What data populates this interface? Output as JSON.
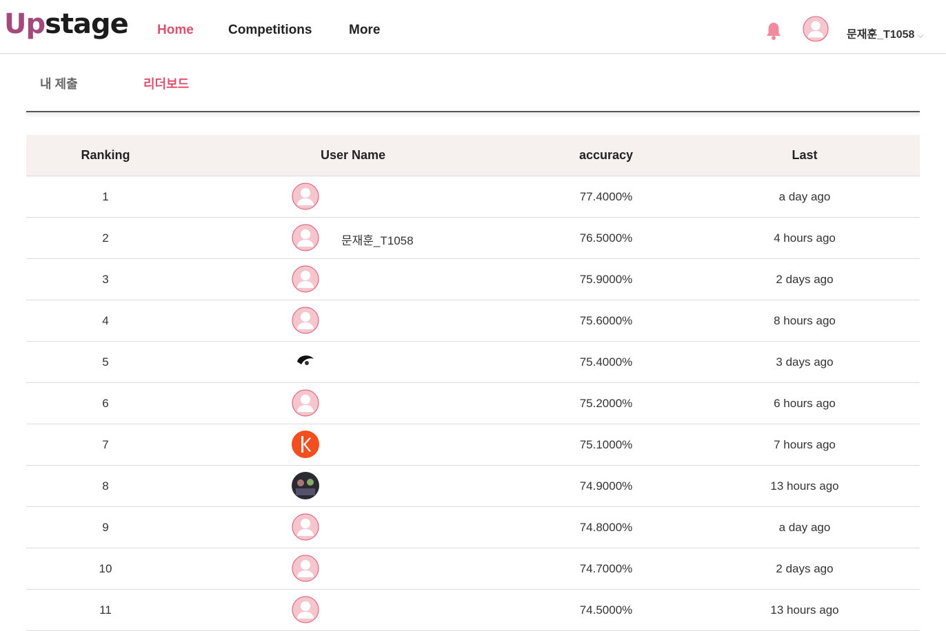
{
  "header": {
    "logo_up": "Up",
    "logo_stage": "stage",
    "nav": [
      {
        "label": "Home",
        "active": true
      },
      {
        "label": "Competitions",
        "active": false
      },
      {
        "label": "More",
        "active": false
      }
    ],
    "user_name": "문재훈_T1058",
    "icons": {
      "bell": "bell-icon",
      "avatar": "avatar-icon",
      "chevron": "chevron-down-icon"
    },
    "accent_color": "#e0506a"
  },
  "subtabs": [
    {
      "label": "내 제출",
      "active": false
    },
    {
      "label": "리더보드",
      "active": true
    }
  ],
  "leaderboard": {
    "columns": [
      "Ranking",
      "User Name",
      "accuracy",
      "Last"
    ],
    "rows": [
      {
        "rank": "1",
        "user": "",
        "avatar": "default",
        "accuracy": "77.4000%",
        "last": "a day ago"
      },
      {
        "rank": "2",
        "user": "문재훈_T1058",
        "avatar": "default",
        "accuracy": "76.5000%",
        "last": "4 hours ago"
      },
      {
        "rank": "3",
        "user": "",
        "avatar": "default",
        "accuracy": "75.9000%",
        "last": "2 days ago"
      },
      {
        "rank": "4",
        "user": "",
        "avatar": "default",
        "accuracy": "75.6000%",
        "last": "8 hours ago"
      },
      {
        "rank": "5",
        "user": "",
        "avatar": "custom-dark",
        "accuracy": "75.4000%",
        "last": "3 days ago"
      },
      {
        "rank": "6",
        "user": "",
        "avatar": "default",
        "accuracy": "75.2000%",
        "last": "6 hours ago"
      },
      {
        "rank": "7",
        "user": "",
        "avatar": "custom-orange",
        "accuracy": "75.1000%",
        "last": "7 hours ago"
      },
      {
        "rank": "8",
        "user": "",
        "avatar": "custom-photo",
        "accuracy": "74.9000%",
        "last": "13 hours ago"
      },
      {
        "rank": "9",
        "user": "",
        "avatar": "default",
        "accuracy": "74.8000%",
        "last": "a day ago"
      },
      {
        "rank": "10",
        "user": "",
        "avatar": "default",
        "accuracy": "74.7000%",
        "last": "2 days ago"
      },
      {
        "rank": "11",
        "user": "",
        "avatar": "default",
        "accuracy": "74.5000%",
        "last": "13 hours ago"
      }
    ]
  }
}
